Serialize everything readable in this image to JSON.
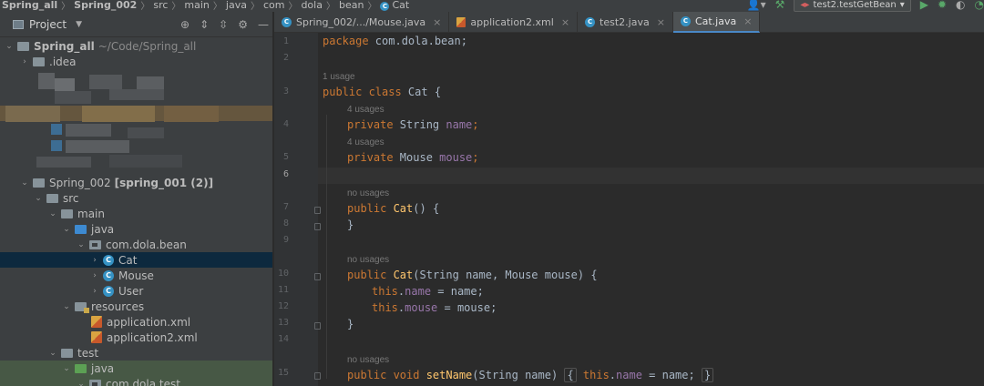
{
  "breadcrumbs": [
    "Spring_all",
    "Spring_002",
    "src",
    "main",
    "java",
    "com",
    "dola",
    "bean",
    "Cat"
  ],
  "run_config": {
    "label": "test2.testGetBean"
  },
  "project_panel": {
    "title": "Project",
    "root": {
      "name": "Spring_all",
      "path": "~/Code/Spring_all"
    },
    "items": [
      {
        "name": ".idea"
      },
      {
        "name": "Spring_002",
        "module": "[spring_001 (2)]"
      },
      {
        "name": "src"
      },
      {
        "name": "main"
      },
      {
        "name": "java"
      },
      {
        "name": "com.dola.bean"
      },
      {
        "name": "Cat"
      },
      {
        "name": "Mouse"
      },
      {
        "name": "User"
      },
      {
        "name": "resources"
      },
      {
        "name": "application.xml"
      },
      {
        "name": "application2.xml"
      },
      {
        "name": "test"
      },
      {
        "name": "java"
      },
      {
        "name": "com.dola.test"
      }
    ]
  },
  "tabs": [
    {
      "label": "Spring_002/.../Mouse.java",
      "type": "class"
    },
    {
      "label": "application2.xml",
      "type": "xml"
    },
    {
      "label": "test2.java",
      "type": "class"
    },
    {
      "label": "Cat.java",
      "type": "class",
      "active": true
    }
  ],
  "editor": {
    "line_numbers": [
      "1",
      "2",
      "3",
      "4",
      "5",
      "6",
      "7",
      "8",
      "9",
      "10",
      "11",
      "12",
      "13",
      "14",
      "15"
    ],
    "hints": [
      "1 usage",
      "4 usages",
      "4 usages",
      "no usages",
      "no usages",
      "no usages"
    ],
    "code": {
      "l1_kw": "package",
      "l1_rest": " com.dola.bean;",
      "l3_kw": "public class",
      "l3_rest": " Cat {",
      "l4_kw": "private",
      "l4_type": " String ",
      "l4_field": "name",
      "l4_end": ";",
      "l5_kw": "private",
      "l5_type": " Mouse ",
      "l5_field": "mouse",
      "l5_end": ";",
      "l7_kw": "public",
      "l7_name": " Cat",
      "l7_rest": "() {",
      "l8": "}",
      "l10_kw": "public",
      "l10_name": " Cat",
      "l10_rest": "(String name, Mouse mouse) {",
      "l11_kw": "this",
      "l11_dot": ".",
      "l11_field": "name",
      "l11_rest": " = name;",
      "l12_kw": "this",
      "l12_dot": ".",
      "l12_field": "mouse",
      "l12_rest": " = mouse;",
      "l13": "}",
      "l15_kw": "public void",
      "l15_name": " setName",
      "l15_args": "(String name) ",
      "l15_open": "{",
      "l15_this": " this",
      "l15_dot": ".",
      "l15_field": "name",
      "l15_assign": " = name; ",
      "l15_close": "}"
    }
  }
}
